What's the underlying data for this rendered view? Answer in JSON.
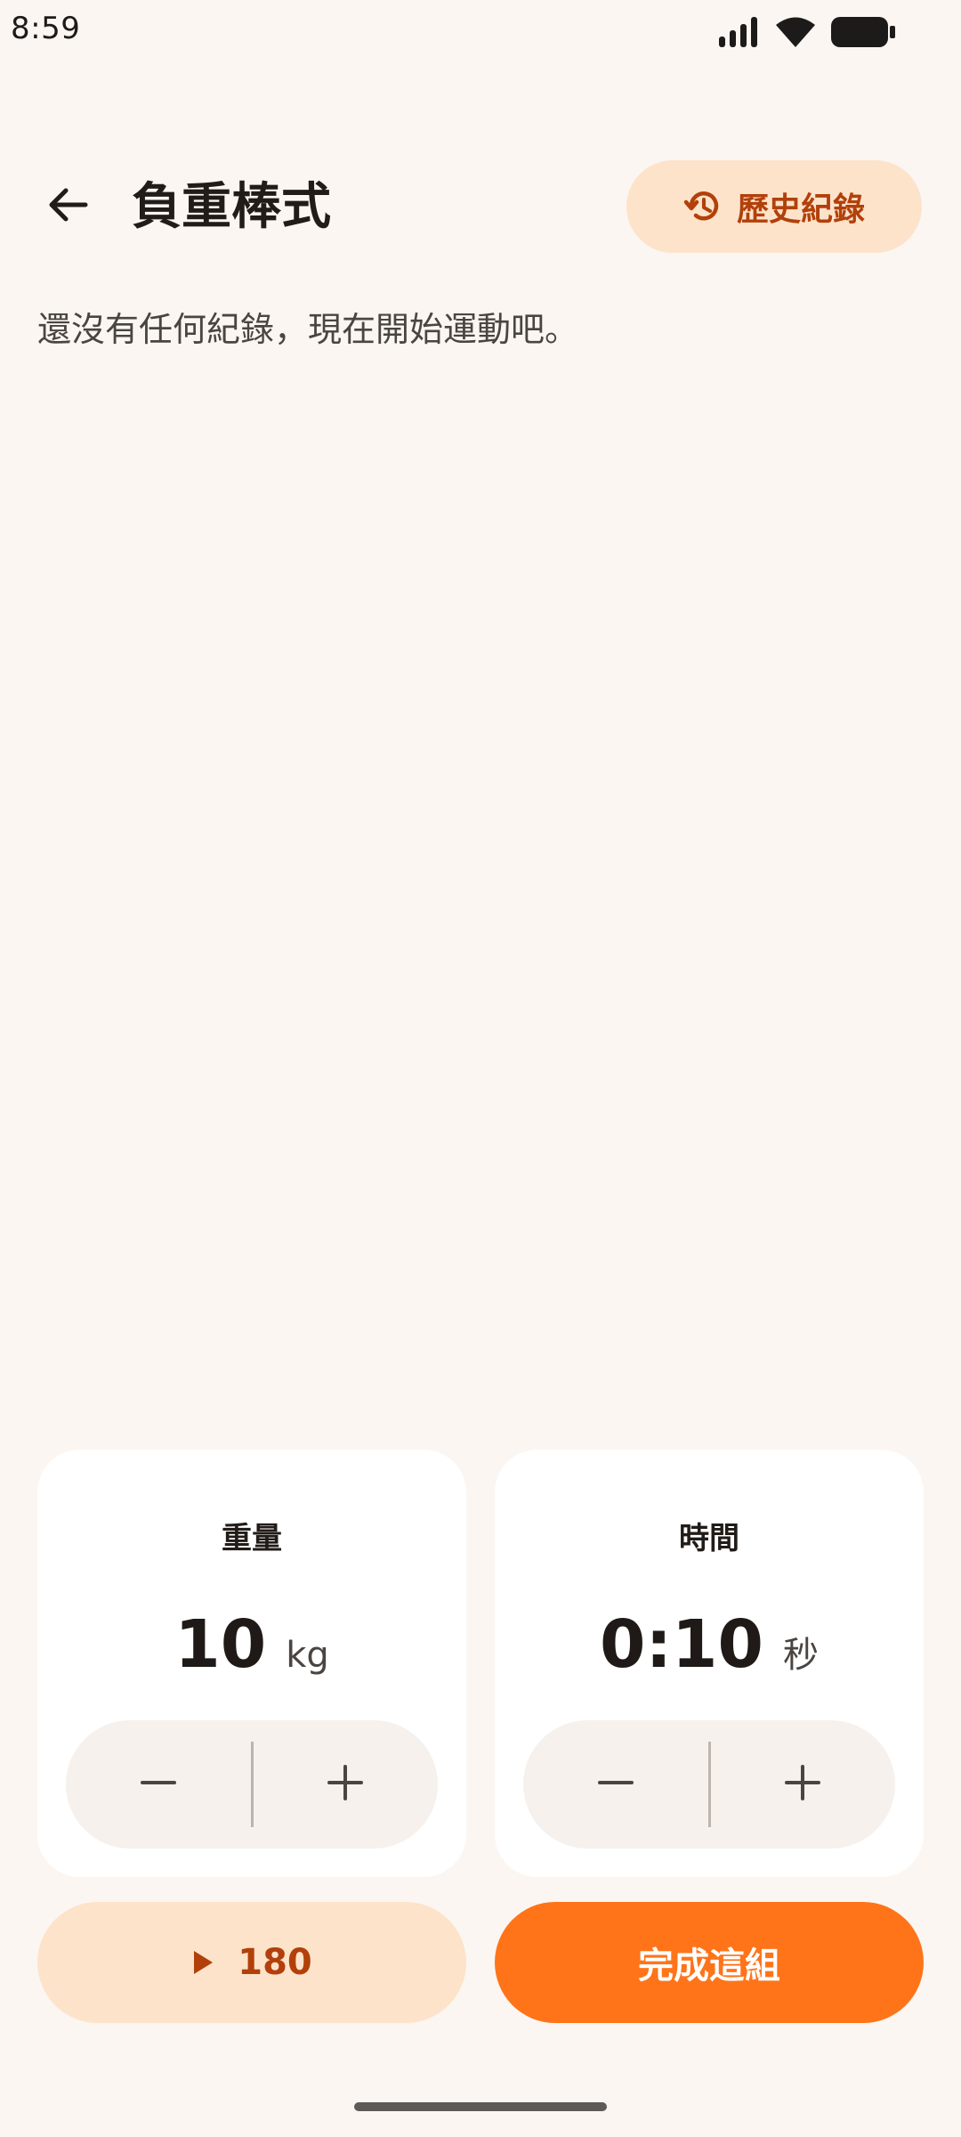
{
  "status_bar": {
    "time": "8:59",
    "icons": [
      "cellular-signal-icon",
      "wifi-icon",
      "battery-icon"
    ]
  },
  "header": {
    "back_icon": "arrow-left-icon",
    "title": "負重棒式",
    "history_button": {
      "icon": "history-icon",
      "label": "歷史紀錄"
    }
  },
  "empty_message": "還沒有任何紀錄，現在開始運動吧。",
  "weight_card": {
    "label": "重量",
    "value": "10",
    "unit": "kg",
    "decrement_icon": "minus-icon",
    "increment_icon": "plus-icon"
  },
  "time_card": {
    "label": "時間",
    "value": "0:10",
    "unit": "秒",
    "decrement_icon": "minus-icon",
    "increment_icon": "plus-icon"
  },
  "rest_button": {
    "icon": "play-icon",
    "label": "180"
  },
  "complete_button": {
    "label": "完成這組"
  },
  "colors": {
    "background": "#FBF6F2",
    "accent": "#FF7419",
    "accent_soft": "#FDE3CA",
    "accent_text": "#B2400B",
    "card": "#FFFFFF",
    "stepper": "#F6F1EC"
  }
}
